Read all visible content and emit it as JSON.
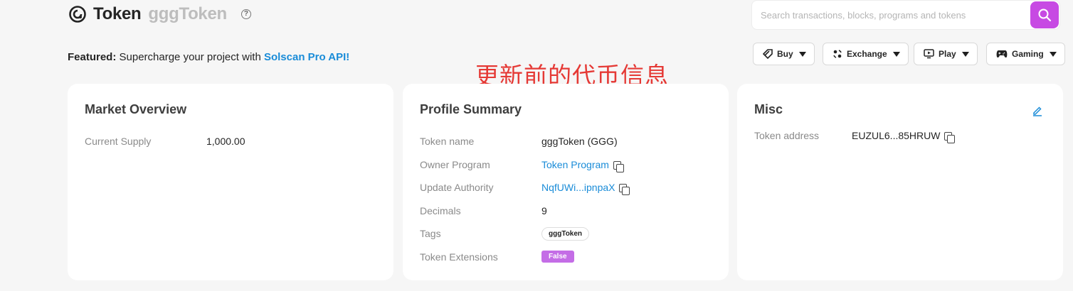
{
  "header": {
    "title": "Token",
    "token_name": "gggToken",
    "help_glyph": "?"
  },
  "search": {
    "placeholder": "Search transactions, blocks, programs and tokens"
  },
  "featured": {
    "label": "Featured:",
    "text": " Supercharge your project with ",
    "link": "Solscan Pro API!"
  },
  "annotation": "更新前的代币信息",
  "nav": [
    {
      "label": "Buy",
      "icon": "tag-icon"
    },
    {
      "label": "Exchange",
      "icon": "exchange-icon"
    },
    {
      "label": "Play",
      "icon": "play-icon"
    },
    {
      "label": "Gaming",
      "icon": "gamepad-icon"
    }
  ],
  "market": {
    "title": "Market Overview",
    "rows": [
      {
        "label": "Current Supply",
        "value": "1,000.00"
      }
    ]
  },
  "profile": {
    "title": "Profile Summary",
    "token_name_label": "Token name",
    "token_name_value": "gggToken (GGG)",
    "owner_label": "Owner Program",
    "owner_value": "Token Program",
    "authority_label": "Update Authority",
    "authority_value": "NqfUWi...ipnpaX",
    "decimals_label": "Decimals",
    "decimals_value": "9",
    "tags_label": "Tags",
    "tags_value": "gggToken",
    "extensions_label": "Token Extensions",
    "extensions_value": "False"
  },
  "misc": {
    "title": "Misc",
    "address_label": "Token address",
    "address_value": "EUZUL6...85HRUW"
  },
  "colors": {
    "accent": "#c74ae3",
    "link": "#1a8cd8",
    "badge": "#c46de6",
    "annotation": "#e53935"
  }
}
